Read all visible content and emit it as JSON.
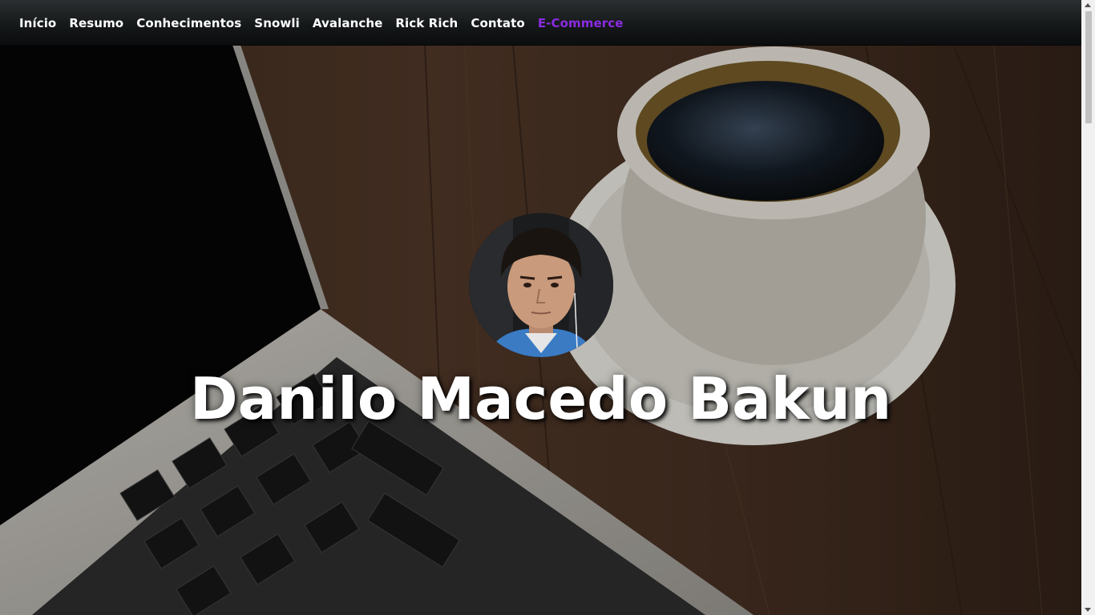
{
  "nav": {
    "items": [
      {
        "label": "Início"
      },
      {
        "label": "Resumo"
      },
      {
        "label": "Conhecimentos"
      },
      {
        "label": "Snowli"
      },
      {
        "label": "Avalanche"
      },
      {
        "label": "Rick Rich"
      },
      {
        "label": "Contato"
      },
      {
        "label": "E-Commerce"
      }
    ],
    "active_index": 7
  },
  "hero": {
    "name": "Danilo Macedo Bakun",
    "avatar": "profile-photo"
  },
  "colors": {
    "nav_background": "#141718",
    "nav_text": "#ffffff",
    "nav_active": "#8a2be2",
    "hero_text": "#ffffff"
  }
}
